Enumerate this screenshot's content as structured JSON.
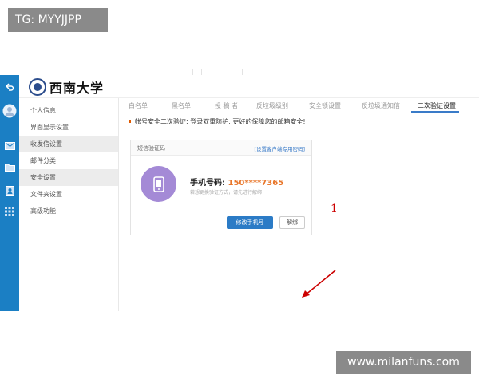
{
  "overlay": {
    "tg_badge": "TG: MYYJJPP",
    "watermark": "www.milanfuns.com"
  },
  "header": {
    "logo_text": "西南大学"
  },
  "sidebar": {
    "items": [
      {
        "label": "个人信息"
      },
      {
        "label": "界面显示设置"
      },
      {
        "label": "收发信设置"
      },
      {
        "label": "邮件分类"
      },
      {
        "label": "安全设置"
      },
      {
        "label": "文件夹设置"
      },
      {
        "label": "高级功能"
      }
    ]
  },
  "tabs": [
    {
      "label": "白名单"
    },
    {
      "label": "黑名单"
    },
    {
      "label": "投 稿 者"
    },
    {
      "label": "反垃圾级别"
    },
    {
      "label": "安全锁设置"
    },
    {
      "label": "反垃圾通知信"
    },
    {
      "label": "二次验证设置"
    }
  ],
  "notice": {
    "text": "帐号安全二次验证: 登录双重防护, 更好的保障您的邮箱安全!"
  },
  "card": {
    "title": "短信验证码",
    "link": "[设置客户端专用密码]",
    "phone_label": "手机号码:",
    "phone_number": "150****7365",
    "phone_hint": "若想更换验证方式，请先进行解绑",
    "modify_button": "修改手机号",
    "unbind_button": "解绑"
  },
  "annotation": {
    "number": "1"
  }
}
